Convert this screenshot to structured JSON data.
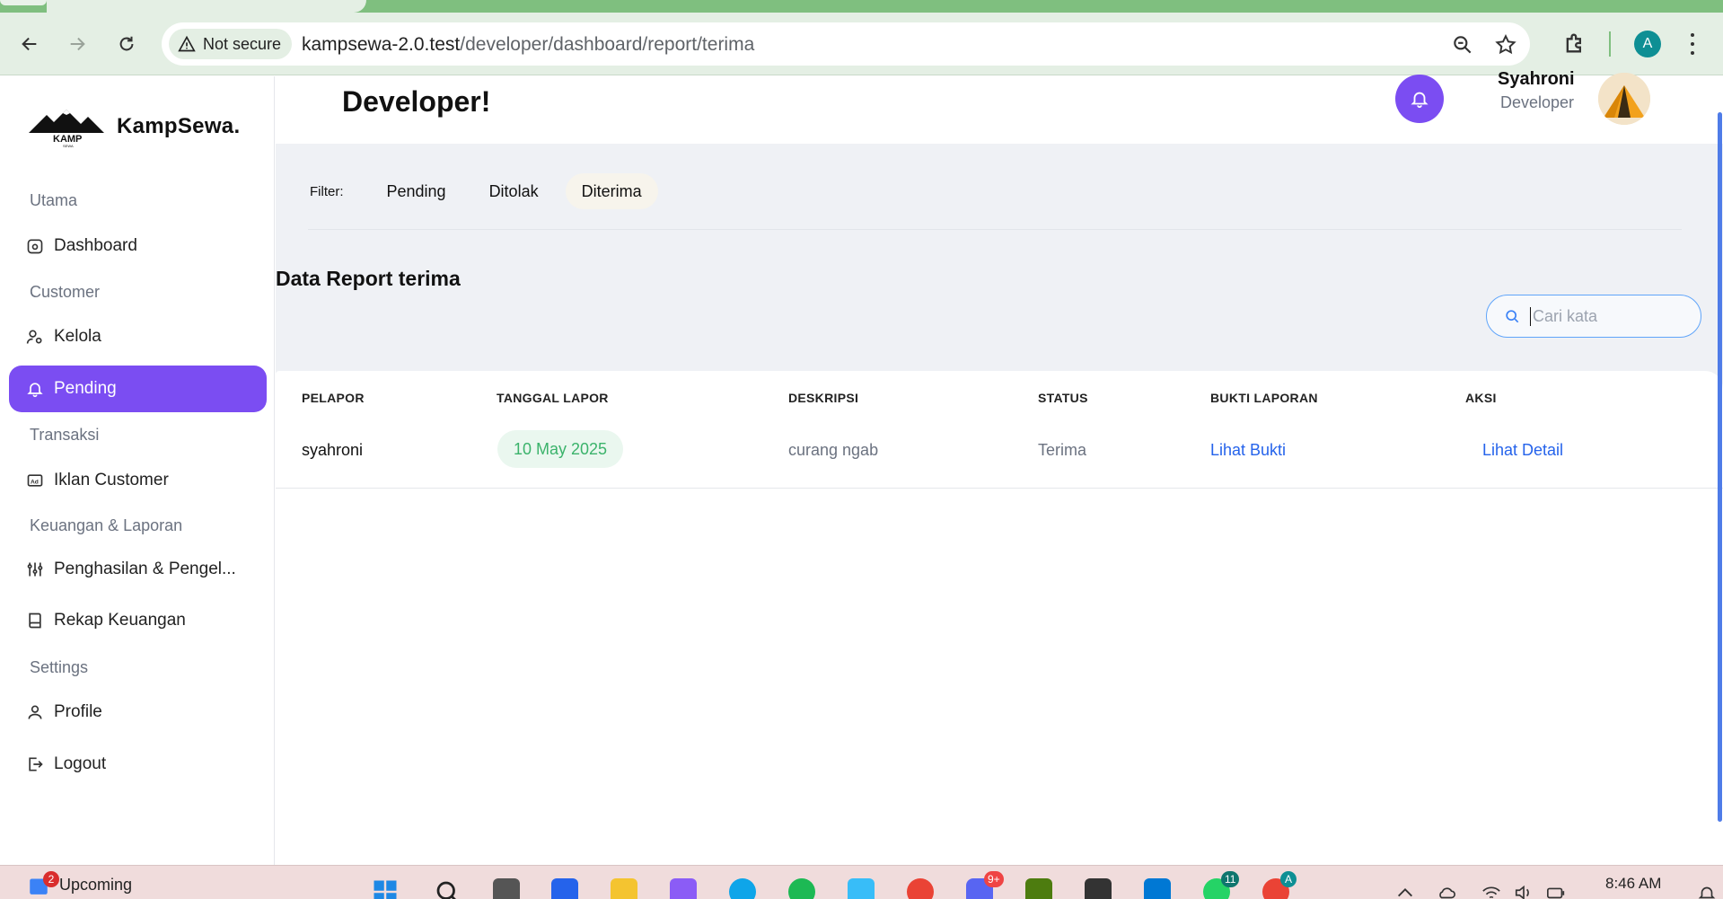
{
  "browser": {
    "security_label": "Not secure",
    "url_host": "kampsewa-2.0.test",
    "url_path": "/developer/dashboard/report/terima",
    "profile_initial": "A"
  },
  "sidebar": {
    "logo_text": "KampSewa.",
    "sections": {
      "utama": "Utama",
      "customer": "Customer",
      "transaksi": "Transaksi",
      "keuangan": "Keuangan & Laporan",
      "settings": "Settings"
    },
    "items": {
      "dashboard": "Dashboard",
      "kelola": "Kelola",
      "pending": "Pending",
      "iklan": "Iklan Customer",
      "penghasilan": "Penghasilan & Pengel...",
      "rekap": "Rekap Keuangan",
      "profile": "Profile",
      "logout": "Logout"
    }
  },
  "header": {
    "greeting": "Developer!",
    "user_name": "Syahroni",
    "user_role": "Developer"
  },
  "filter": {
    "label": "Filter:",
    "options": [
      "Pending",
      "Ditolak",
      "Diterima"
    ],
    "active": "Diterima"
  },
  "section_title": "Data Report terima",
  "search": {
    "placeholder": "Cari kata",
    "value": ""
  },
  "table": {
    "columns": [
      "PELAPOR",
      "TANGGAL LAPOR",
      "DESKRIPSI",
      "STATUS",
      "BUKTI LAPORAN",
      "AKSI"
    ],
    "rows": [
      {
        "pelapor": "syahroni",
        "tanggal": "10 May 2025",
        "deskripsi": "curang ngab",
        "status": "Terima",
        "bukti": "Lihat Bukti",
        "aksi": "Lihat Detail"
      }
    ]
  },
  "taskbar": {
    "weather_label": "Upcoming",
    "weather_badge": "2",
    "clock": "8:46 AM",
    "badges": {
      "discord": "9+",
      "whatsapp": "11",
      "chrome_profile": "A"
    }
  },
  "colors": {
    "accent": "#7b4df2",
    "link": "#2563eb",
    "date_green": "#3bb36b",
    "content_bg": "#eff1f5",
    "browser_green": "#7fbf7f"
  }
}
